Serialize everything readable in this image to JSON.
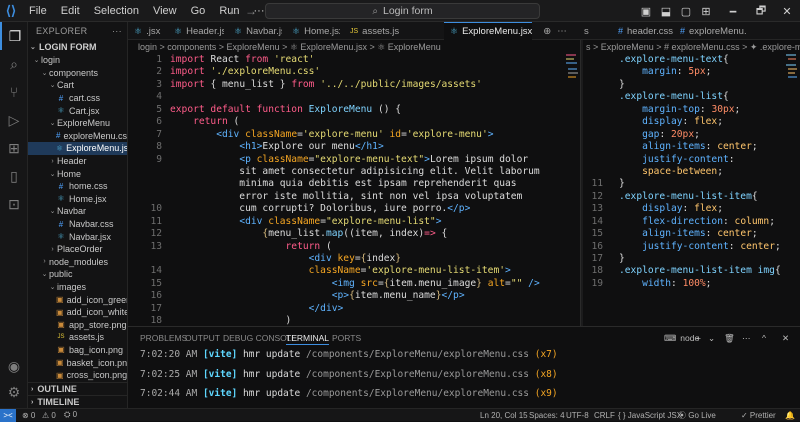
{
  "titlebar": {
    "menus": [
      "File",
      "Edit",
      "Selection",
      "View",
      "Go",
      "Run"
    ],
    "more": "···",
    "back": "←",
    "forward": "→",
    "search": "Login form",
    "window": [
      "🗕",
      "🗗",
      "✕"
    ]
  },
  "activity": {
    "icons": [
      "files-icon",
      "search-icon",
      "source-control-icon",
      "run-debug-icon",
      "extensions-icon",
      "mobile-icon",
      "remote-icon"
    ]
  },
  "explorer": {
    "header": "EXPLORER",
    "more": "···",
    "root": "LOGIN FORM",
    "items": [
      {
        "label": "login",
        "indent": 0,
        "type": "folder",
        "open": true
      },
      {
        "label": "components",
        "indent": 1,
        "type": "folder",
        "open": true
      },
      {
        "label": "Cart",
        "indent": 2,
        "type": "folder",
        "open": true
      },
      {
        "label": "cart.css",
        "indent": 3,
        "type": "css"
      },
      {
        "label": "Cart.jsx",
        "indent": 3,
        "type": "jsx"
      },
      {
        "label": "ExploreMenu",
        "indent": 2,
        "type": "folder",
        "open": true
      },
      {
        "label": "exploreMenu.css",
        "indent": 3,
        "type": "css"
      },
      {
        "label": "ExploreMenu.jsx",
        "indent": 3,
        "type": "jsx",
        "selected": true
      },
      {
        "label": "Header",
        "indent": 2,
        "type": "folder",
        "open": false
      },
      {
        "label": "Home",
        "indent": 2,
        "type": "folder",
        "open": true
      },
      {
        "label": "home.css",
        "indent": 3,
        "type": "css"
      },
      {
        "label": "Home.jsx",
        "indent": 3,
        "type": "jsx"
      },
      {
        "label": "Navbar",
        "indent": 2,
        "type": "folder",
        "open": true
      },
      {
        "label": "Navbar.css",
        "indent": 3,
        "type": "css"
      },
      {
        "label": "Navbar.jsx",
        "indent": 3,
        "type": "jsx"
      },
      {
        "label": "PlaceOrder",
        "indent": 2,
        "type": "folder",
        "open": false
      },
      {
        "label": "node_modules",
        "indent": 1,
        "type": "folder",
        "open": false
      },
      {
        "label": "public",
        "indent": 1,
        "type": "folder",
        "open": true
      },
      {
        "label": "images",
        "indent": 2,
        "type": "folder",
        "open": true
      },
      {
        "label": "add_icon_green.p...",
        "indent": 3,
        "type": "img"
      },
      {
        "label": "add_icon_white.p...",
        "indent": 3,
        "type": "img"
      },
      {
        "label": "app_store.png",
        "indent": 3,
        "type": "img"
      },
      {
        "label": "assets.js",
        "indent": 3,
        "type": "js"
      },
      {
        "label": "bag_icon.png",
        "indent": 3,
        "type": "img"
      },
      {
        "label": "basket_icon.png",
        "indent": 3,
        "type": "img"
      },
      {
        "label": "cross_icon.png",
        "indent": 3,
        "type": "img"
      }
    ],
    "outline": "OUTLINE",
    "timeline": "TIMELINE"
  },
  "tabsL": [
    {
      "label": ".jsx",
      "type": "jsx"
    },
    {
      "label": "Header.jsx",
      "type": "jsx"
    },
    {
      "label": "Navbar.jsx",
      "type": "jsx"
    },
    {
      "label": "Home.jsx",
      "type": "jsx"
    },
    {
      "label": "assets.js",
      "type": "js"
    },
    {
      "label": "ExploreMenu.jsx",
      "type": "jsx",
      "active": true
    }
  ],
  "tabsR": [
    {
      "label": "s"
    },
    {
      "label": "header.css",
      "type": "css"
    },
    {
      "label": "exploreMenu.css",
      "type": "css"
    }
  ],
  "tabClose": "×",
  "splitIcons": [
    "⊕",
    "⋯"
  ],
  "crumbL": "login > components > ExploreMenu > ⚛ ExploreMenu.jsx > ⚛ ExploreMenu",
  "crumbR": "s > ExploreMenu > # exploreMenu.css > ✦ .explore-menu-list",
  "editorL": {
    "lineNumbers": [
      "1",
      "2",
      "3",
      "4",
      "5",
      "6",
      "7",
      "8",
      "9",
      "",
      "",
      "",
      "10",
      "11",
      "12",
      "13",
      "",
      "14",
      "15",
      "16",
      "17",
      "18",
      "19"
    ],
    "lines": [
      [
        [
          "kw",
          "import "
        ],
        [
          "pl",
          "React "
        ],
        [
          "kw",
          "from "
        ],
        [
          "str",
          "'react'"
        ]
      ],
      [
        [
          "kw",
          "import "
        ],
        [
          "str",
          "'./exploreMenu.css'"
        ]
      ],
      [
        [
          "kw",
          "import "
        ],
        [
          "pl",
          "{ menu_list } "
        ],
        [
          "kw",
          "from "
        ],
        [
          "str",
          "'../../public/images/assets'"
        ]
      ],
      [
        [
          "pl",
          ""
        ]
      ],
      [
        [
          "kw",
          "export default function "
        ],
        [
          "fn",
          "ExploreMenu"
        ],
        [
          "pl",
          " () {"
        ]
      ],
      [
        [
          "pl",
          "    "
        ],
        [
          "kw",
          "return"
        ],
        [
          "pl",
          " ("
        ]
      ],
      [
        [
          "pl",
          "        "
        ],
        [
          "tag",
          "<div "
        ],
        [
          "attr",
          "className"
        ],
        [
          "pl",
          "="
        ],
        [
          "str",
          "'explore-menu'"
        ],
        [
          "pl",
          " "
        ],
        [
          "attr",
          "id"
        ],
        [
          "pl",
          "="
        ],
        [
          "str",
          "'explore-menu'"
        ],
        [
          "tag",
          ">"
        ]
      ],
      [
        [
          "pl",
          "            "
        ],
        [
          "tag",
          "<h1>"
        ],
        [
          "pl",
          "Explore our menu"
        ],
        [
          "tag",
          "</h1>"
        ]
      ],
      [
        [
          "pl",
          "            "
        ],
        [
          "tag",
          "<p "
        ],
        [
          "attr",
          "className"
        ],
        [
          "pl",
          "="
        ],
        [
          "str",
          "\"explore-menu-text\""
        ],
        [
          "tag",
          ">"
        ],
        [
          "pl",
          "Lorem ipsum dolor"
        ]
      ],
      [
        [
          "pl",
          "            sit amet consectetur adipisicing elit. Velit laborum"
        ]
      ],
      [
        [
          "pl",
          "            minima quia debitis est ipsam reprehenderit quas"
        ]
      ],
      [
        [
          "pl",
          "            error iste mollitia, sint non vel ipsa voluptatem"
        ]
      ],
      [
        [
          "pl",
          "            cum corrupti? Doloribus, iure porro."
        ],
        [
          "tag",
          "</p>"
        ]
      ],
      [
        [
          "pl",
          "            "
        ],
        [
          "tag",
          "<div "
        ],
        [
          "attr",
          "className"
        ],
        [
          "pl",
          "="
        ],
        [
          "str",
          "\"explore-menu-list\""
        ],
        [
          "tag",
          ">"
        ]
      ],
      [
        [
          "pl",
          "                "
        ],
        [
          "br",
          "{"
        ],
        [
          "pl",
          "menu_list."
        ],
        [
          "fn",
          "map"
        ],
        [
          "pl",
          "((item, index)"
        ],
        [
          "kw",
          "=>"
        ],
        [
          "pl",
          " {"
        ]
      ],
      [
        [
          "pl",
          "                    "
        ],
        [
          "kw",
          "return"
        ],
        [
          "pl",
          " ("
        ]
      ],
      [
        [
          "pl",
          "                        "
        ],
        [
          "tag",
          "<div "
        ],
        [
          "attr",
          "key"
        ],
        [
          "pl",
          "="
        ],
        [
          "br",
          "{"
        ],
        [
          "pl",
          "index"
        ],
        [
          "br",
          "}"
        ]
      ],
      [
        [
          "pl",
          "                        "
        ],
        [
          "attr",
          "className"
        ],
        [
          "pl",
          "="
        ],
        [
          "str",
          "'explore-menu-list-item'"
        ],
        [
          "tag",
          ">"
        ]
      ],
      [
        [
          "pl",
          "                            "
        ],
        [
          "tag",
          "<img "
        ],
        [
          "attr",
          "src"
        ],
        [
          "pl",
          "="
        ],
        [
          "br",
          "{"
        ],
        [
          "pl",
          "item.menu_image"
        ],
        [
          "br",
          "}"
        ],
        [
          "pl",
          " "
        ],
        [
          "attr",
          "alt"
        ],
        [
          "pl",
          "="
        ],
        [
          "str",
          "\"\""
        ],
        [
          "pl",
          " "
        ],
        [
          "tag",
          "/>"
        ]
      ],
      [
        [
          "pl",
          "                            "
        ],
        [
          "tag",
          "<p>"
        ],
        [
          "br",
          "{"
        ],
        [
          "pl",
          "item.menu_name"
        ],
        [
          "br",
          "}"
        ],
        [
          "tag",
          "</p>"
        ]
      ],
      [
        [
          "pl",
          "                        "
        ],
        [
          "tag",
          "</div>"
        ]
      ],
      [
        [
          "pl",
          "                    )"
        ]
      ],
      [
        [
          "pl",
          "                "
        ],
        [
          "br",
          "}"
        ],
        [
          "pl",
          ")"
        ],
        [
          "br",
          "}"
        ]
      ]
    ]
  },
  "editorR": {
    "lineNumbers": [
      "",
      "",
      "",
      "",
      "",
      "",
      "",
      "",
      "",
      "",
      "11",
      "12",
      "13",
      "14",
      "15",
      "16",
      "17",
      "18",
      "19"
    ],
    "lines": [
      [
        [
          "cs",
          ".explore-menu-text"
        ],
        [
          "pl",
          "{"
        ]
      ],
      [
        [
          "pl",
          "    "
        ],
        [
          "cp",
          "margin"
        ],
        [
          "pl",
          ": "
        ],
        [
          "num",
          "5px"
        ],
        [
          "pl",
          ";"
        ]
      ],
      [
        [
          "pl",
          "}"
        ]
      ],
      [
        [
          "cs",
          ".explore-menu-list"
        ],
        [
          "pl",
          "{"
        ]
      ],
      [
        [
          "pl",
          "    "
        ],
        [
          "cp",
          "margin-top"
        ],
        [
          "pl",
          ": "
        ],
        [
          "num",
          "30px"
        ],
        [
          "pl",
          ";"
        ]
      ],
      [
        [
          "pl",
          "    "
        ],
        [
          "cp",
          "display"
        ],
        [
          "pl",
          ": "
        ],
        [
          "cv",
          "flex"
        ],
        [
          "pl",
          ";"
        ]
      ],
      [
        [
          "pl",
          "    "
        ],
        [
          "cp",
          "gap"
        ],
        [
          "pl",
          ": "
        ],
        [
          "num",
          "20px"
        ],
        [
          "pl",
          ";"
        ]
      ],
      [
        [
          "pl",
          "    "
        ],
        [
          "cp",
          "align-items"
        ],
        [
          "pl",
          ": "
        ],
        [
          "cv",
          "center"
        ],
        [
          "pl",
          ";"
        ]
      ],
      [
        [
          "pl",
          "    "
        ],
        [
          "cp",
          "justify-content"
        ],
        [
          "pl",
          ":"
        ]
      ],
      [
        [
          "pl",
          "    "
        ],
        [
          "cv",
          "space-between"
        ],
        [
          "pl",
          ";"
        ]
      ],
      [
        [
          "pl",
          "}"
        ]
      ],
      [
        [
          "cs",
          ".explore-menu-list-item"
        ],
        [
          "pl",
          "{"
        ]
      ],
      [
        [
          "pl",
          "    "
        ],
        [
          "cp",
          "display"
        ],
        [
          "pl",
          ": "
        ],
        [
          "cv",
          "flex"
        ],
        [
          "pl",
          ";"
        ]
      ],
      [
        [
          "pl",
          "    "
        ],
        [
          "cp",
          "flex-direction"
        ],
        [
          "pl",
          ": "
        ],
        [
          "cv",
          "column"
        ],
        [
          "pl",
          ";"
        ]
      ],
      [
        [
          "pl",
          "    "
        ],
        [
          "cp",
          "align-items"
        ],
        [
          "pl",
          ": "
        ],
        [
          "cv",
          "center"
        ],
        [
          "pl",
          ";"
        ]
      ],
      [
        [
          "pl",
          "    "
        ],
        [
          "cp",
          "justify-content"
        ],
        [
          "pl",
          ": "
        ],
        [
          "cv",
          "center"
        ],
        [
          "pl",
          ";"
        ]
      ],
      [
        [
          "pl",
          "}"
        ]
      ],
      [
        [
          "cs",
          ".explore-menu-list-item img"
        ],
        [
          "pl",
          "{"
        ]
      ],
      [
        [
          "pl",
          "    "
        ],
        [
          "cp",
          "width"
        ],
        [
          "pl",
          ": "
        ],
        [
          "num",
          "100%"
        ],
        [
          "pl",
          ";"
        ]
      ]
    ]
  },
  "panel": {
    "tabs": [
      "PROBLEMS",
      "OUTPUT",
      "DEBUG CONSOLE",
      "TERMINAL",
      "PORTS"
    ],
    "activeTab": "TERMINAL",
    "shell": "node",
    "shellIcon": "⌨",
    "controls": [
      "+",
      "⌄",
      "🗑",
      "⋯",
      "^",
      "✕"
    ],
    "lines": [
      {
        "time": "7:02:20 AM",
        "tag": "[vite]",
        "msg": "hmr update",
        "path": "/components/ExploreMenu/exploreMenu.css",
        "count": "(x7)"
      },
      {
        "time": "7:02:25 AM",
        "tag": "[vite]",
        "msg": "hmr update",
        "path": "/components/ExploreMenu/exploreMenu.css",
        "count": "(x8)"
      },
      {
        "time": "7:02:44 AM",
        "tag": "[vite]",
        "msg": "hmr update",
        "path": "/components/ExploreMenu/exploreMenu.css",
        "count": "(x9)"
      }
    ]
  },
  "status": {
    "remote": "><",
    "errors": "⊗ 0",
    "warnings": "⚠ 0",
    "ports": "⛭ 0",
    "position": "Ln 20, Col 15",
    "spaces": "Spaces: 4",
    "encoding": "UTF-8",
    "eol": "CRLF",
    "language": "{ } JavaScript JSX",
    "golive": "⦿ Go Live",
    "prettier": "✓ Prettier",
    "bell": "🔔"
  },
  "colors": {
    "accent": "#3d8ee0",
    "selection": "#1f3a5a",
    "keyword": "#ff5c8a",
    "string": "#e6db74",
    "tag": "#5fb3ff"
  }
}
